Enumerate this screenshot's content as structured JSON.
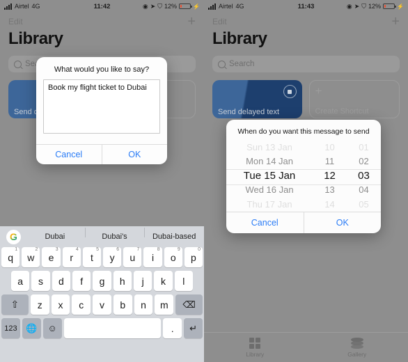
{
  "left": {
    "statusbar": {
      "carrier": "Airtel",
      "network": "4G",
      "time": "11:42",
      "battery_pct": "12%"
    },
    "nav": {
      "edit": "Edit",
      "add": "+"
    },
    "title": "Library",
    "search_placeholder": "Search",
    "cards": [
      {
        "label": "Send delayed text",
        "type": "filled"
      },
      {
        "label": "Create Shortcut",
        "type": "ghost"
      }
    ],
    "dialog": {
      "title": "What would you like to say?",
      "input_value": "Book my flight ticket to Dubai",
      "cancel": "Cancel",
      "ok": "OK"
    },
    "keyboard": {
      "suggestions": [
        "Dubai",
        "Dubai's",
        "Dubai-based"
      ],
      "logo": "G",
      "row1": [
        {
          "k": "q",
          "n": "1"
        },
        {
          "k": "w",
          "n": "2"
        },
        {
          "k": "e",
          "n": "3"
        },
        {
          "k": "r",
          "n": "4"
        },
        {
          "k": "t",
          "n": "5"
        },
        {
          "k": "y",
          "n": "6"
        },
        {
          "k": "u",
          "n": "7"
        },
        {
          "k": "i",
          "n": "8"
        },
        {
          "k": "o",
          "n": "9"
        },
        {
          "k": "p",
          "n": "0"
        }
      ],
      "row2": [
        "a",
        "s",
        "d",
        "f",
        "g",
        "h",
        "j",
        "k",
        "l"
      ],
      "row3": [
        "z",
        "x",
        "c",
        "v",
        "b",
        "n",
        "m"
      ],
      "shift": "⇧",
      "backspace": "⌫",
      "numbers": "123",
      "globe": "⊕",
      "emoji": "☺",
      "space": "",
      "period": ".",
      "enter": "↵"
    }
  },
  "right": {
    "statusbar": {
      "carrier": "Airtel",
      "network": "4G",
      "time": "11:43",
      "battery_pct": "12%"
    },
    "nav": {
      "edit": "Edit",
      "add": "+"
    },
    "title": "Library",
    "search_placeholder": "Search",
    "cards": [
      {
        "label": "Send delayed text",
        "type": "filled"
      },
      {
        "label": "Create Shortcut",
        "type": "ghost"
      }
    ],
    "picker": {
      "title": "When do you want this message to send",
      "cancel": "Cancel",
      "ok": "OK",
      "date_column": [
        "Sun 13 Jan",
        "Mon 14 Jan",
        "Tue 15 Jan",
        "Wed 16 Jan",
        "Thu 17 Jan"
      ],
      "hour_column": [
        "10",
        "11",
        "12",
        "13",
        "14"
      ],
      "minute_column": [
        "01",
        "02",
        "03",
        "04",
        "05"
      ],
      "selected_index": 2,
      "selected_date": "Tue 15 Jan",
      "selected_hour": "12",
      "selected_minute": "03"
    },
    "tabbar": [
      {
        "label": "Library",
        "icon": "grid-icon"
      },
      {
        "label": "Gallery",
        "icon": "layers-icon"
      }
    ]
  },
  "colors": {
    "accent": "#2a7cf6",
    "card": "#1d3f6e",
    "battery": "#ef4b2c"
  }
}
